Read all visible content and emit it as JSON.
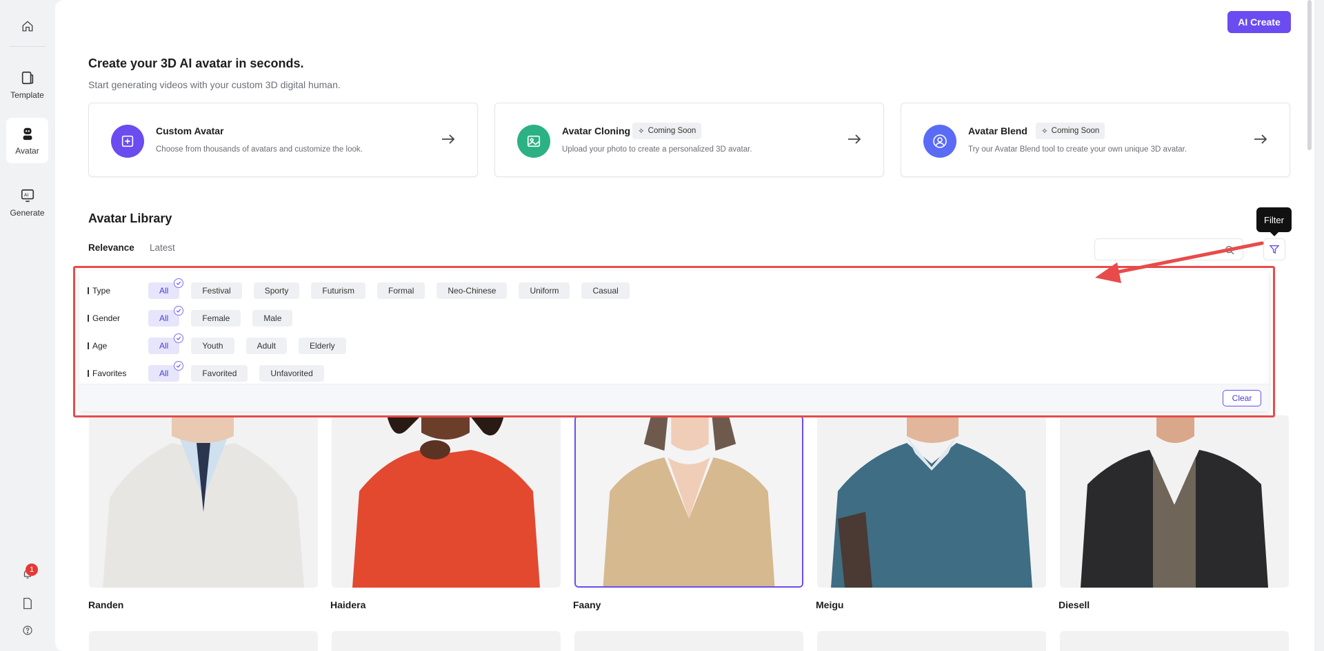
{
  "sidebar": {
    "items": [
      {
        "label": "Template"
      },
      {
        "label": "Avatar"
      },
      {
        "label": "Generate"
      }
    ],
    "notification_count": "1"
  },
  "header": {
    "ai_create_label": "AI Create"
  },
  "hero": {
    "title": "Create your 3D AI avatar in seconds.",
    "subtitle": "Start generating videos with your custom 3D digital human."
  },
  "features": [
    {
      "title": "Custom Avatar",
      "desc": "Choose from thousands of avatars and customize the look.",
      "color": "#6a4cf0"
    },
    {
      "title": "Avatar Cloning",
      "badge": "Coming Soon",
      "desc": "Upload your photo to create a personalized 3D avatar.",
      "color": "#2bb184"
    },
    {
      "title": "Avatar Blend",
      "badge": "Coming Soon",
      "desc": "Try our Avatar Blend tool to create your own unique 3D avatar.",
      "color": "#5a6cf5"
    }
  ],
  "library": {
    "title": "Avatar Library",
    "sort_tabs": [
      "Relevance",
      "Latest"
    ],
    "search_placeholder": "",
    "filter_tooltip": "Filter"
  },
  "filters": {
    "rows": [
      {
        "label": "Type",
        "options": [
          "All",
          "Festival",
          "Sporty",
          "Futurism",
          "Formal",
          "Neo-Chinese",
          "Uniform",
          "Casual"
        ],
        "selected": "All"
      },
      {
        "label": "Gender",
        "options": [
          "All",
          "Female",
          "Male"
        ],
        "selected": "All"
      },
      {
        "label": "Age",
        "options": [
          "All",
          "Youth",
          "Adult",
          "Elderly"
        ],
        "selected": "All"
      },
      {
        "label": "Favorites",
        "options": [
          "All",
          "Favorited",
          "Unfavorited"
        ],
        "selected": "All"
      }
    ],
    "clear_label": "Clear"
  },
  "avatars": [
    {
      "name": "Randen"
    },
    {
      "name": "Haidera"
    },
    {
      "name": "Faany"
    },
    {
      "name": "Meigu"
    },
    {
      "name": "Diesell"
    }
  ],
  "colors": {
    "accent": "#6a4cf0",
    "highlight_annotation": "#e84b4b"
  }
}
